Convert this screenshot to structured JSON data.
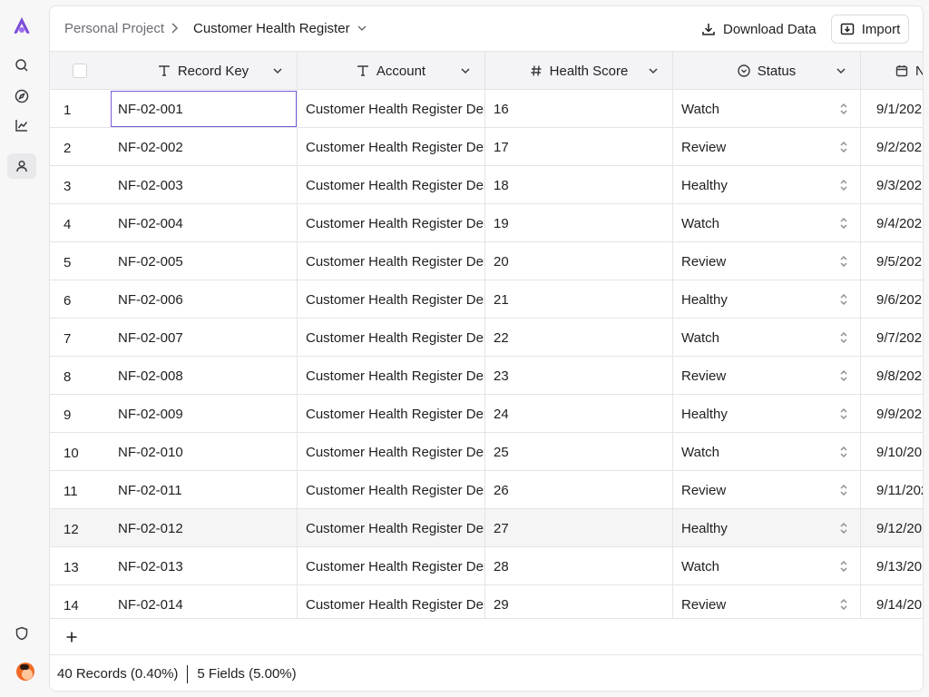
{
  "app": {
    "accent": "#7c5cd6",
    "logo_color": "#7c4dd8"
  },
  "rail": {
    "items": [
      {
        "name": "search-icon",
        "active": false
      },
      {
        "name": "compass-icon",
        "active": false
      },
      {
        "name": "chart-icon",
        "active": false
      },
      {
        "name": "user-icon",
        "active": true
      }
    ],
    "bottom": [
      "shield-icon",
      "avatar"
    ]
  },
  "topbar": {
    "breadcrumb_parent": "Personal Project",
    "breadcrumb_current": "Customer Health Register",
    "download_label": "Download Data",
    "import_label": "Import"
  },
  "columns": [
    {
      "label": "Record Key",
      "icon": "text-icon"
    },
    {
      "label": "Account",
      "icon": "text-icon"
    },
    {
      "label": "Health Score",
      "icon": "hash-icon"
    },
    {
      "label": "Status",
      "icon": "status-icon"
    },
    {
      "label": "N",
      "icon": "calendar-icon"
    }
  ],
  "rows": [
    {
      "idx": "1",
      "key": "NF-02-001",
      "account": "Customer Health Register Der",
      "score": "16",
      "status": "Watch",
      "date": "9/1/202"
    },
    {
      "idx": "2",
      "key": "NF-02-002",
      "account": "Customer Health Register Der",
      "score": "17",
      "status": "Review",
      "date": "9/2/202"
    },
    {
      "idx": "3",
      "key": "NF-02-003",
      "account": "Customer Health Register Der",
      "score": "18",
      "status": "Healthy",
      "date": "9/3/202"
    },
    {
      "idx": "4",
      "key": "NF-02-004",
      "account": "Customer Health Register Der",
      "score": "19",
      "status": "Watch",
      "date": "9/4/202"
    },
    {
      "idx": "5",
      "key": "NF-02-005",
      "account": "Customer Health Register Der",
      "score": "20",
      "status": "Review",
      "date": "9/5/202"
    },
    {
      "idx": "6",
      "key": "NF-02-006",
      "account": "Customer Health Register Der",
      "score": "21",
      "status": "Healthy",
      "date": "9/6/202"
    },
    {
      "idx": "7",
      "key": "NF-02-007",
      "account": "Customer Health Register Der",
      "score": "22",
      "status": "Watch",
      "date": "9/7/202"
    },
    {
      "idx": "8",
      "key": "NF-02-008",
      "account": "Customer Health Register Der",
      "score": "23",
      "status": "Review",
      "date": "9/8/202"
    },
    {
      "idx": "9",
      "key": "NF-02-009",
      "account": "Customer Health Register Der",
      "score": "24",
      "status": "Healthy",
      "date": "9/9/202"
    },
    {
      "idx": "10",
      "key": "NF-02-010",
      "account": "Customer Health Register Der",
      "score": "25",
      "status": "Watch",
      "date": "9/10/20"
    },
    {
      "idx": "11",
      "key": "NF-02-011",
      "account": "Customer Health Register Der",
      "score": "26",
      "status": "Review",
      "date": "9/11/202"
    },
    {
      "idx": "12",
      "key": "NF-02-012",
      "account": "Customer Health Register Der",
      "score": "27",
      "status": "Healthy",
      "date": "9/12/20"
    },
    {
      "idx": "13",
      "key": "NF-02-013",
      "account": "Customer Health Register Der",
      "score": "28",
      "status": "Watch",
      "date": "9/13/20"
    },
    {
      "idx": "14",
      "key": "NF-02-014",
      "account": "Customer Health Register Der",
      "score": "29",
      "status": "Review",
      "date": "9/14/20"
    }
  ],
  "selected_row": 0,
  "hover_row": 11,
  "footer": {
    "records": "40 Records (0.40%)",
    "fields": "5 Fields (5.00%)"
  }
}
